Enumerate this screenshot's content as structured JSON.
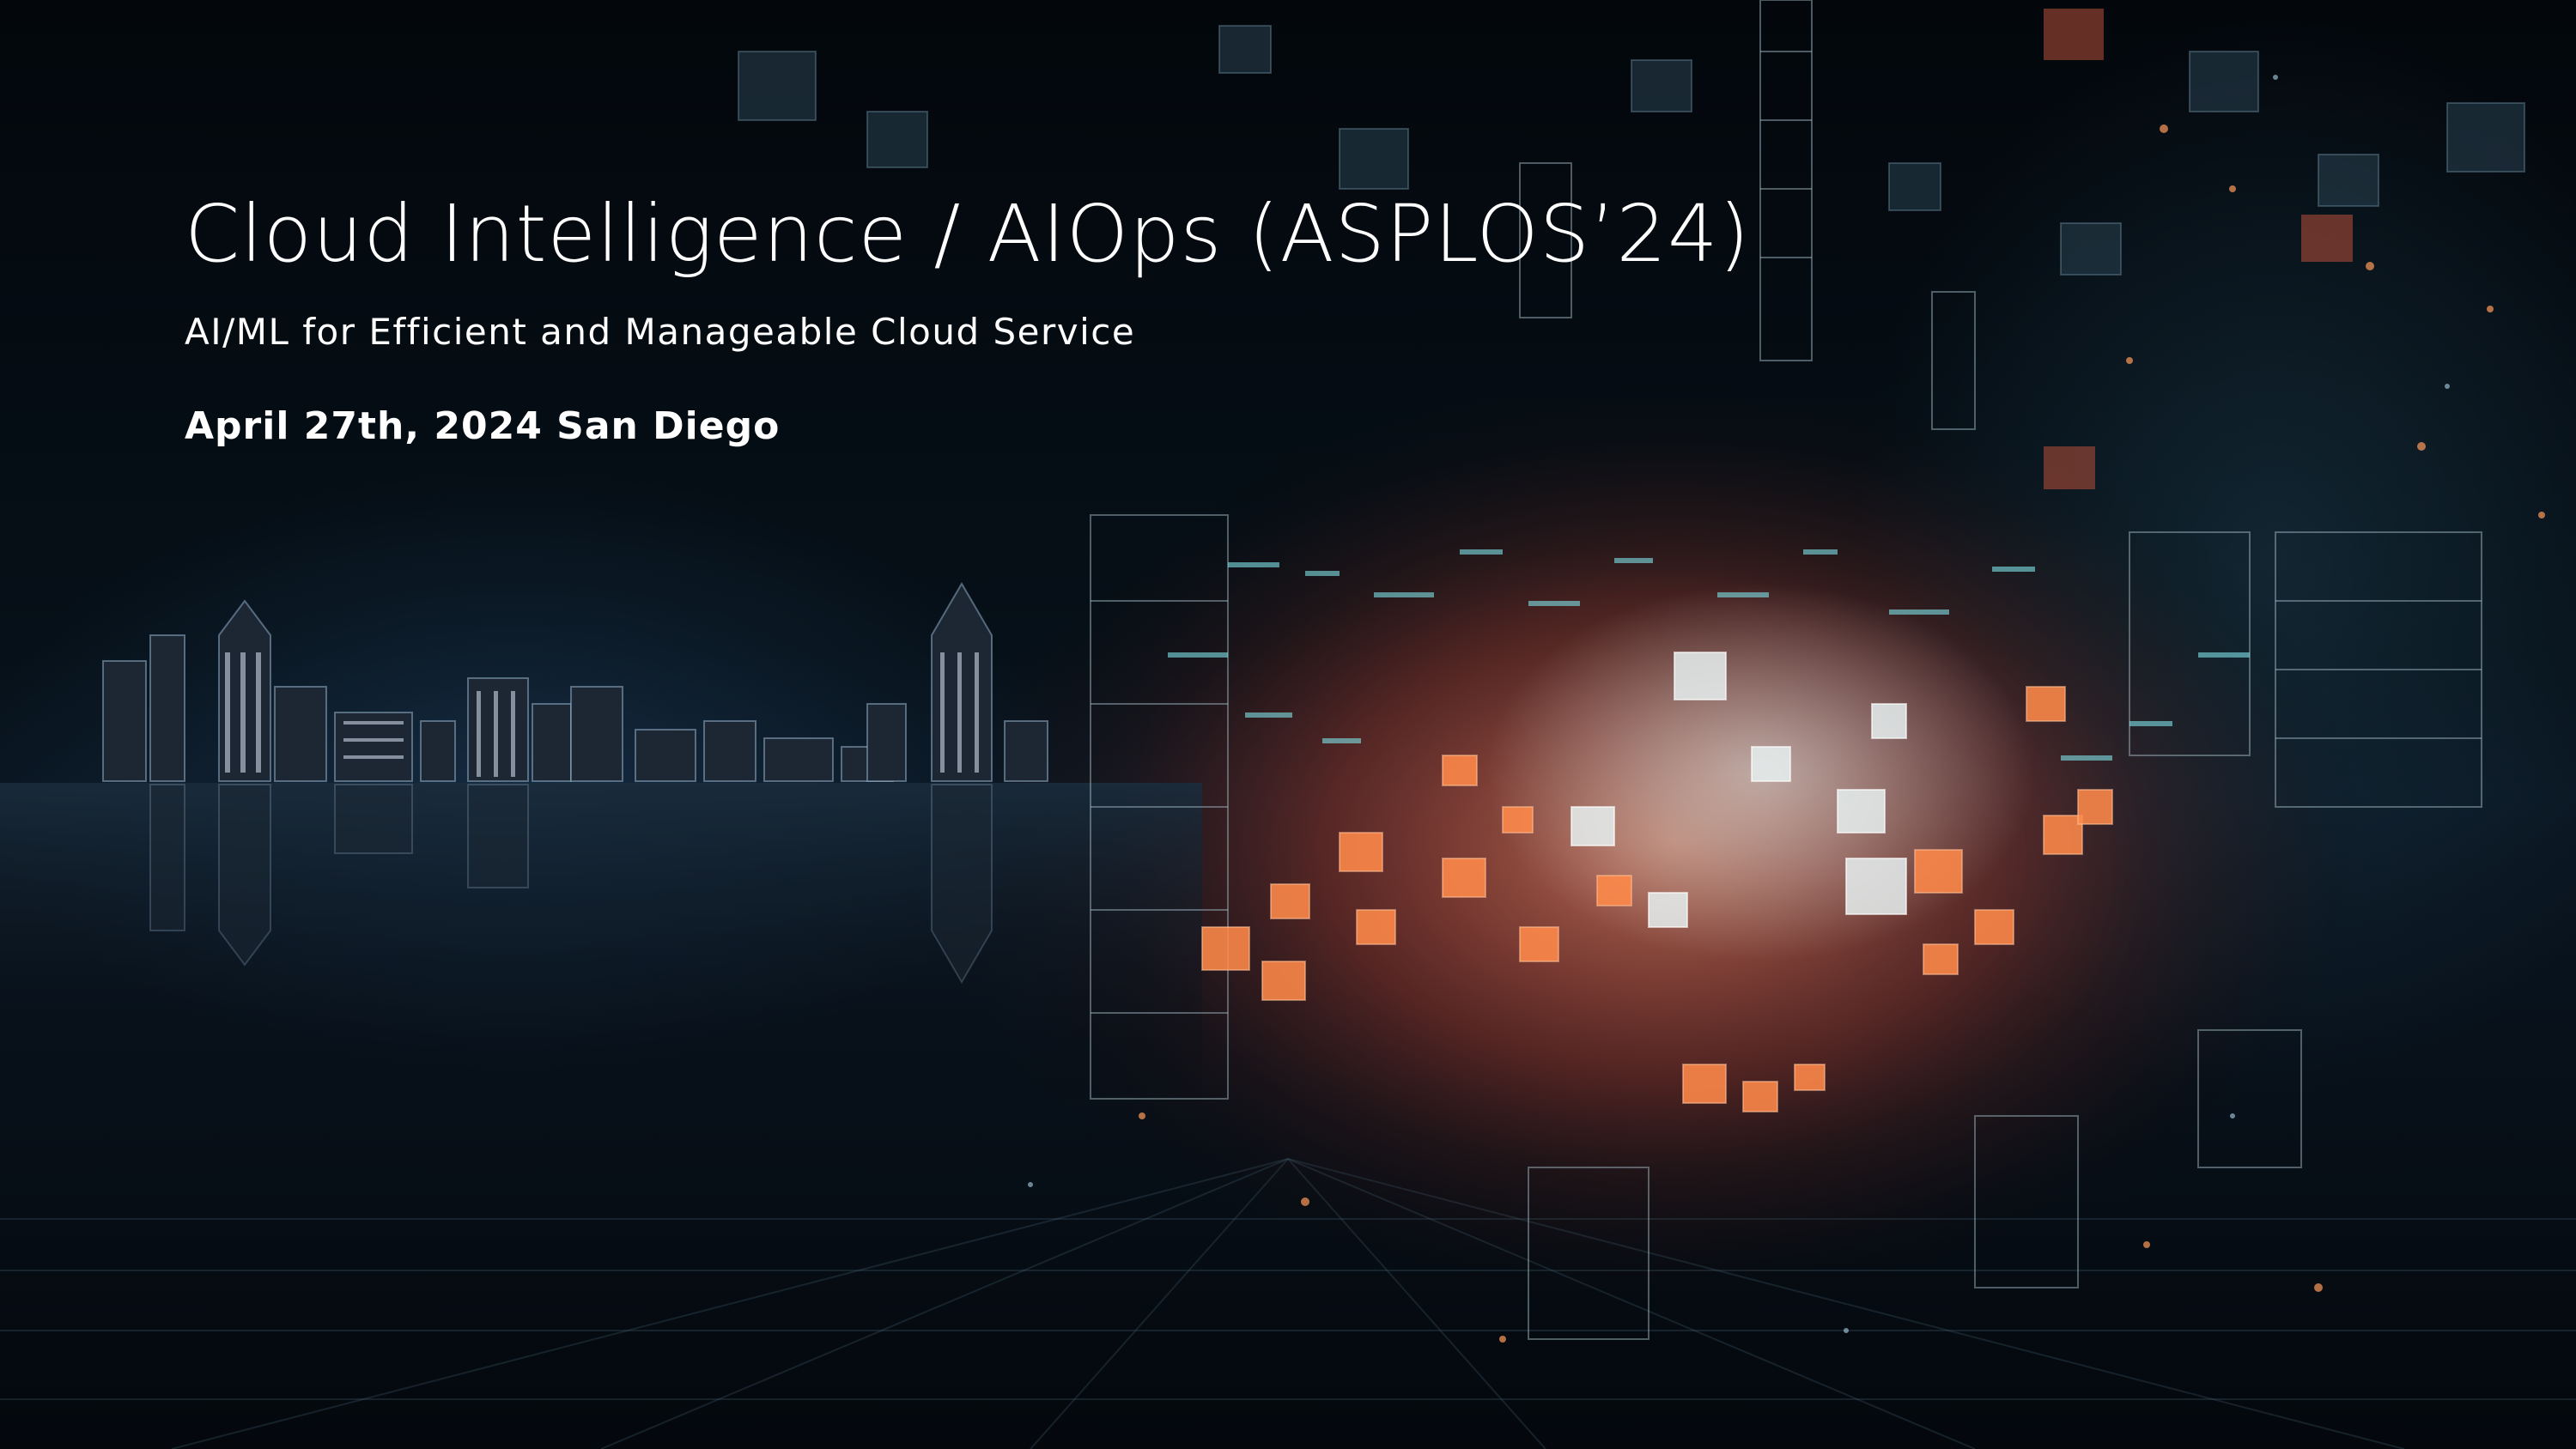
{
  "slide": {
    "title": "Cloud Intelligence / AIOps (ASPLOS’24)",
    "subtitle": "AI/ML for Efficient and Manageable Cloud Service",
    "date_location": "April 27th, 2024 San Diego"
  },
  "colors": {
    "background": "#02060b",
    "text": "#ffffff",
    "accent_orange": "#ff8a4a",
    "accent_red": "#c03a30",
    "accent_cyan": "#7fe3e8"
  }
}
